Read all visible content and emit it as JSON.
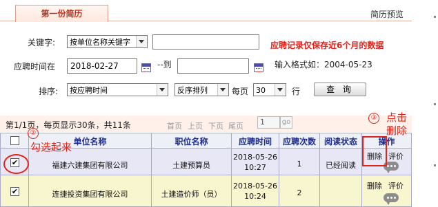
{
  "tabs": {
    "active_label": "第一份简历",
    "preview_link": "简历预览"
  },
  "search": {
    "keyword_label": "关键字:",
    "keyword_scope": "按单位名称关键字",
    "keyword_value": "",
    "notice": "应聘记录仅保存近6个月的数据",
    "date_label": "应聘时间在",
    "date_from": "2018-02-27",
    "date_to_label": "--到",
    "date_to": "",
    "format_hint": "输入格式如：2004-05-23",
    "sort_label": "排序:",
    "sort_field": "按应聘时间",
    "sort_order": "反序排列",
    "per_page_label": "每页",
    "per_page_value": "30",
    "per_page_unit": "行",
    "query_button": "查 询"
  },
  "pager": {
    "info": "第1/1页，每页显示30条，共11条",
    "first": "首页",
    "prev": "上页",
    "next": "下页",
    "last": "尾页",
    "page_value": "1",
    "go": "go"
  },
  "table": {
    "headers": {
      "company": "单位名称",
      "position": "职位名称",
      "apply_time": "应聘时间",
      "apply_count": "应聘次数",
      "read_status": "阅读状态",
      "action": "操作"
    },
    "rows": [
      {
        "checked": "✔",
        "company": "福建六建集团有限公司",
        "position": "土建预算员",
        "date": "2018-05-26",
        "time": "10:27",
        "count": "1",
        "status": "已经阅读",
        "delete": "删除",
        "rate": "评价"
      },
      {
        "checked": "✔",
        "company": "连捷投资集团有限公司",
        "position": "土建造价师（员）",
        "date": "2018-05-26",
        "time": "10:24",
        "count": "2",
        "status": "",
        "delete": "删除",
        "rate": "评价"
      }
    ]
  },
  "annotations": {
    "step2_num": "②",
    "step2_text": "勾选起来",
    "step3_num": "③",
    "step3_text_line1": "点击",
    "step3_text_line2": "删除",
    "color": "#e2231a"
  }
}
